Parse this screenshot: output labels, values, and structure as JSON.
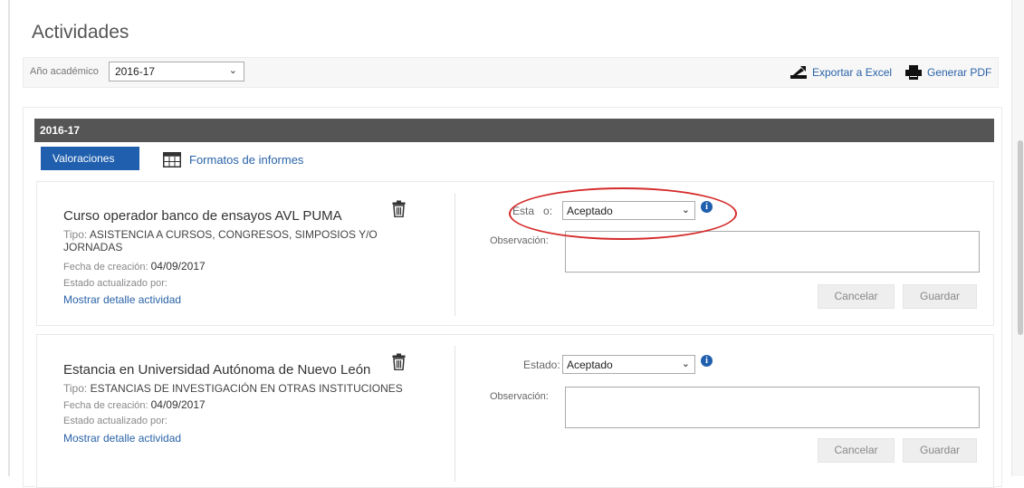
{
  "page": {
    "title": "Actividades"
  },
  "filter": {
    "year_label": "Año académico",
    "year_value": "2016-17",
    "export_excel": "Exportar a Excel",
    "generate_pdf": "Generar PDF"
  },
  "section": {
    "year_header": "2016-17",
    "tabs": [
      {
        "label": "Valoraciones",
        "active": true
      },
      {
        "label": "Formatos de informes",
        "active": false
      }
    ]
  },
  "labels": {
    "tipo": "Tipo:",
    "fecha": "Fecha de creación:",
    "updated_by": "Estado actualizado por:",
    "show_detail": "Mostrar detalle actividad",
    "estado_first": "Esta",
    "estado_first_tail": "o:",
    "estado": "Estado:",
    "observacion": "Observación:",
    "cancel": "Cancelar",
    "save": "Guardar"
  },
  "activities": [
    {
      "title": "Curso operador banco de ensayos AVL PUMA",
      "tipo": "ASISTENCIA A CURSOS, CONGRESOS, SIMPOSIOS Y/O JORNADAS",
      "fecha": "04/09/2017",
      "estado": "Aceptado"
    },
    {
      "title": "Estancia en Universidad Autónoma de Nuevo León",
      "tipo": "ESTANCIAS DE INVESTIGACIÓN EN OTRAS INSTITUCIONES",
      "fecha": "04/09/2017",
      "estado": "Aceptado"
    }
  ],
  "colors": {
    "accent": "#1f5fae",
    "header_bar": "#555555",
    "highlight_ellipse": "#d52b2b"
  },
  "icons": {
    "excel": "excel-export-icon",
    "pdf": "printer-icon",
    "formats": "table-icon",
    "delete": "trash-icon",
    "info": "info-icon"
  }
}
